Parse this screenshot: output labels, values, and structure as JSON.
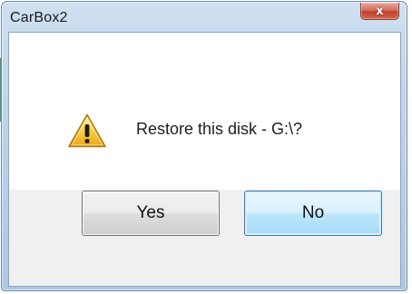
{
  "window": {
    "title": "CarBox2",
    "close_glyph": "x"
  },
  "dialog": {
    "message": "Restore this disk - G:\\?",
    "icon": "warning-icon",
    "buttons": {
      "yes_label": "Yes",
      "no_label": "No"
    }
  },
  "colors": {
    "title_bar": "#bcd3ea",
    "close_button": "#c2412c",
    "focused_button": "#bee6fd",
    "warning_fill": "#f6c02a"
  }
}
